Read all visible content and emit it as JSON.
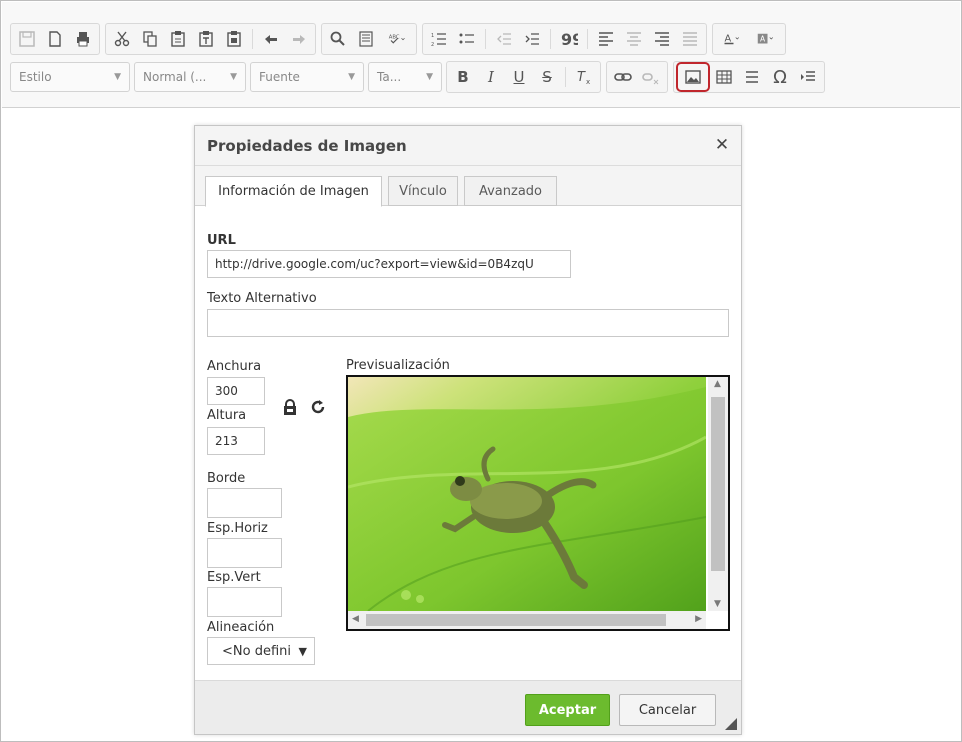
{
  "toolbar": {
    "row1_icons": [
      "save-icon",
      "new-page-icon",
      "print-icon",
      "cut-icon",
      "copy-icon",
      "paste-icon",
      "paste-text-icon",
      "paste-word-icon",
      "undo-icon",
      "redo-icon",
      "find-icon",
      "select-all-icon",
      "spellcheck-icon",
      "numbered-list-icon",
      "bulleted-list-icon",
      "outdent-icon",
      "indent-icon",
      "blockquote-icon",
      "align-left-icon",
      "align-center-icon",
      "align-right-icon",
      "justify-icon",
      "text-color-icon",
      "bg-color-icon"
    ],
    "combos": {
      "style": "Estilo",
      "format": "Normal (...",
      "font": "Fuente",
      "size": "Ta..."
    },
    "format_buttons": {
      "bold": "B",
      "italic": "I",
      "underline": "U",
      "strike": "S",
      "omega": "Ω"
    },
    "highlight_color": "#c0262c"
  },
  "dialog": {
    "title": "Propiedades de Imagen",
    "close_glyph": "✕",
    "tabs": [
      {
        "label": "Información de Imagen",
        "active": true
      },
      {
        "label": "Vínculo",
        "active": false
      },
      {
        "label": "Avanzado",
        "active": false
      }
    ],
    "url": {
      "label": "URL",
      "value": "http://drive.google.com/uc?export=view&id=0B4zqU"
    },
    "alt": {
      "label": "Texto Alternativo",
      "value": ""
    },
    "width": {
      "label": "Anchura",
      "value": "300"
    },
    "height": {
      "label": "Altura",
      "value": "213"
    },
    "border": {
      "label": "Borde",
      "value": ""
    },
    "hspace": {
      "label": "Esp.Horiz",
      "value": ""
    },
    "vspace": {
      "label": "Esp.Vert",
      "value": ""
    },
    "align": {
      "label": "Alineación",
      "value": "<No defini",
      "arrow": "▼"
    },
    "preview": {
      "label": "Previsualización"
    },
    "ok_label": "Aceptar",
    "cancel_label": "Cancelar",
    "ok_color": "#6cbb2e"
  }
}
